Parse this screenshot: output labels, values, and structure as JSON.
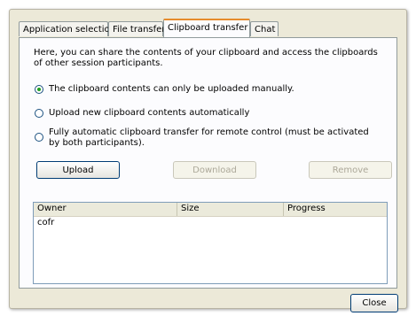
{
  "tabs": [
    {
      "label": "Application selection",
      "active": false
    },
    {
      "label": "File transfer",
      "active": false
    },
    {
      "label": "Clipboard transfer",
      "active": true
    },
    {
      "label": "Chat",
      "active": false
    }
  ],
  "panel": {
    "description": "Here, you can share the contents of your clipboard and access the clipboards of other session participants.",
    "options": [
      {
        "label": "The clipboard contents can only be uploaded manually.",
        "checked": true
      },
      {
        "label": "Upload new clipboard contents automatically",
        "checked": false
      },
      {
        "label": "Fully automatic clipboard transfer for remote control (must be activated by both participants).",
        "checked": false
      }
    ],
    "buttons": {
      "upload": "Upload",
      "download": "Download",
      "remove": "Remove"
    },
    "list": {
      "columns": [
        "Owner",
        "Size",
        "Progress"
      ],
      "rows": [
        {
          "owner": "cofr",
          "size": "",
          "progress": ""
        }
      ]
    }
  },
  "footer": {
    "close": "Close"
  },
  "colors": {
    "tab_highlight": "#e68b2c",
    "dialog_bg": "#ece9d8",
    "button_border": "#003c74",
    "disabled_text": "#aca899"
  }
}
